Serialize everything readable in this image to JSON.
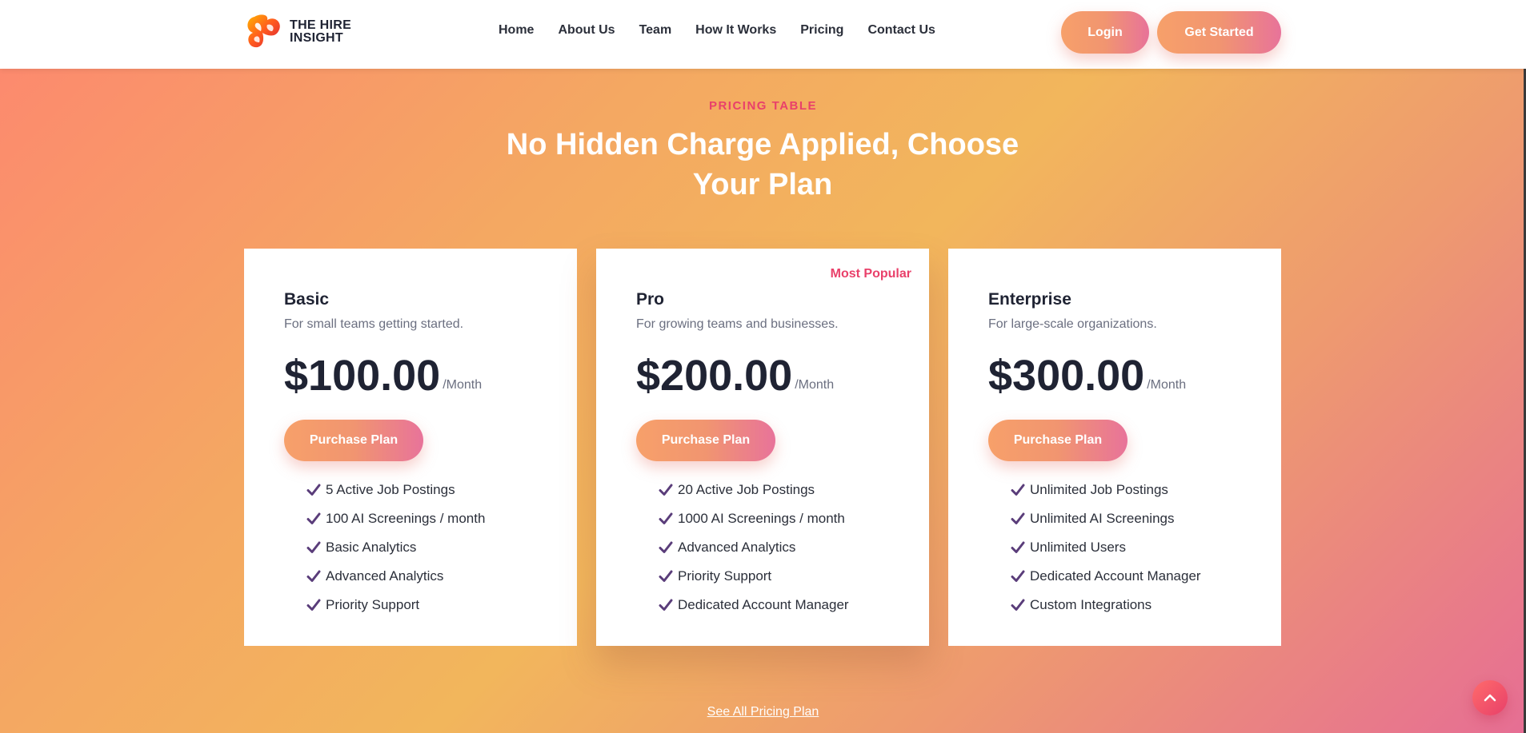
{
  "brand": {
    "line1": "THE HIRE",
    "line2": "INSIGHT"
  },
  "nav": [
    "Home",
    "About Us",
    "Team",
    "How It Works",
    "Pricing",
    "Contact Us"
  ],
  "header_buttons": {
    "login": "Login",
    "get_started": "Get Started"
  },
  "section": {
    "eyebrow": "PRICING TABLE",
    "headline": "No Hidden Charge Applied, Choose Your Plan"
  },
  "plans": [
    {
      "name": "Basic",
      "description": "For small teams getting started.",
      "price": "$100.00",
      "period": "/Month",
      "cta": "Purchase Plan",
      "features": [
        "5 Active Job Postings",
        "100 AI Screenings / month",
        "Basic Analytics",
        "Advanced Analytics",
        "Priority Support"
      ]
    },
    {
      "name": "Pro",
      "badge": "Most Popular",
      "description": "For growing teams and businesses.",
      "price": "$200.00",
      "period": "/Month",
      "cta": "Purchase Plan",
      "features": [
        "20 Active Job Postings",
        "1000 AI Screenings / month",
        "Advanced Analytics",
        "Priority Support",
        "Dedicated Account Manager"
      ]
    },
    {
      "name": "Enterprise",
      "description": "For large-scale organizations.",
      "price": "$300.00",
      "period": "/Month",
      "cta": "Purchase Plan",
      "features": [
        "Unlimited Job Postings",
        "Unlimited AI Screenings",
        "Unlimited Users",
        "Dedicated Account Manager",
        "Custom Integrations"
      ]
    }
  ],
  "see_all_link": "See All Pricing Plan",
  "icons": {
    "check": "check-icon",
    "scroll_top": "chevron-up-icon",
    "logo": "hire-insight-logo-icon"
  },
  "colors": {
    "accent": "#e9406a",
    "check": "#5a3d7a",
    "text_dark": "#1f2333"
  }
}
